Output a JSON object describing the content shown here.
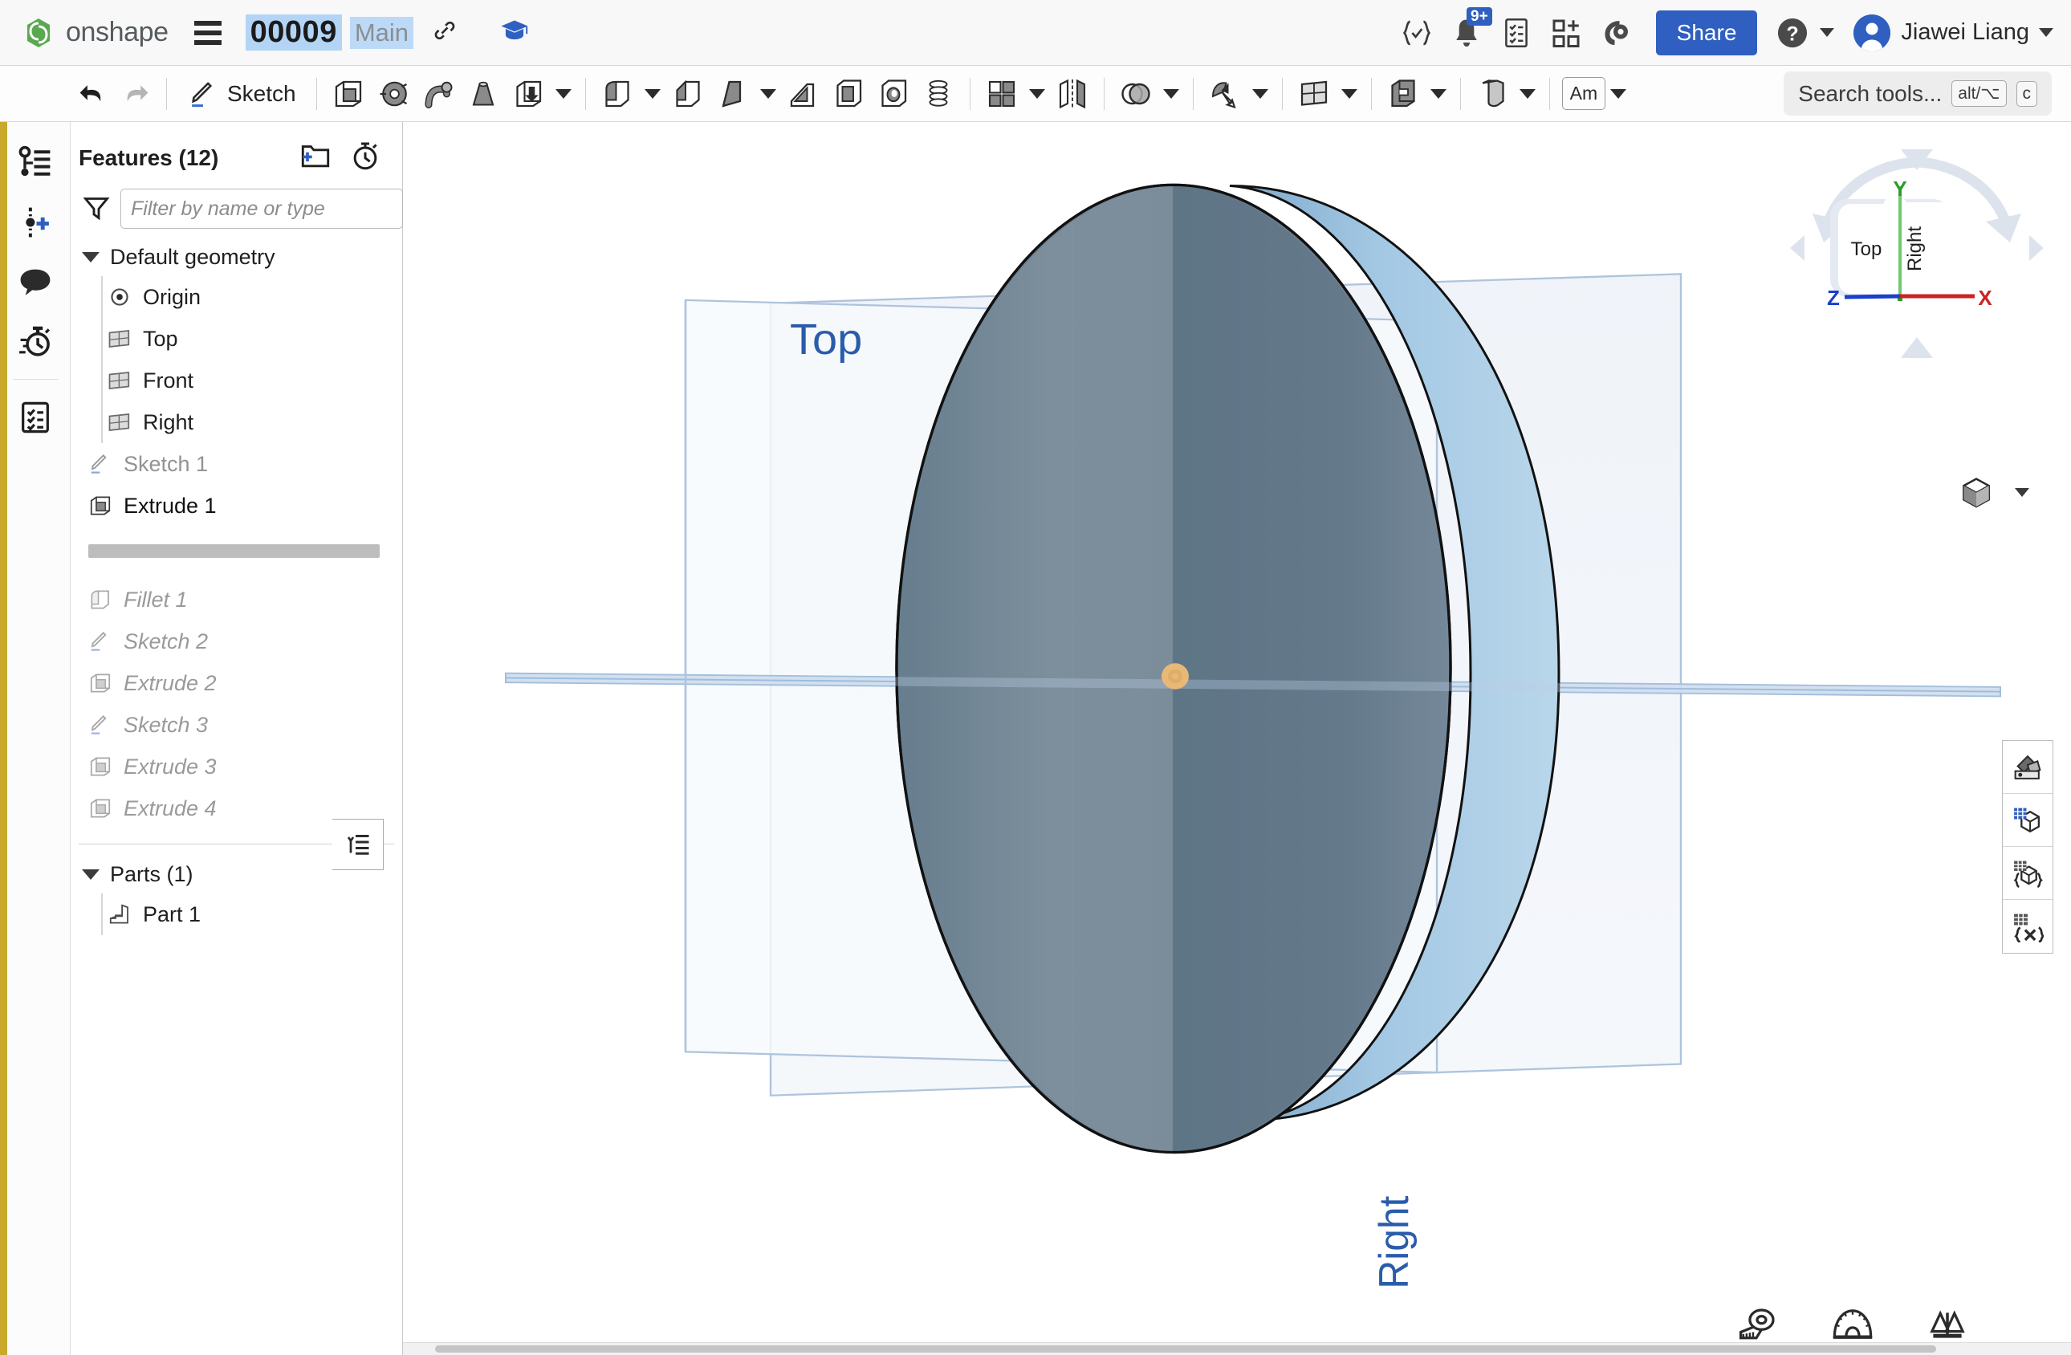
{
  "header": {
    "brand": "onshape",
    "document_title": "00009",
    "branch": "Main",
    "icons": {
      "menu": "hamburger-icon",
      "link": "link-icon",
      "learning": "graduation-cap-icon",
      "variables": "curly-check-icon",
      "notifications": "bell-icon",
      "tasks": "checklist-icon",
      "apps": "apps-add-icon",
      "ai": "brain-gear-icon",
      "help": "help-circle-icon"
    },
    "notification_badge": "9+",
    "share_label": "Share",
    "user_name": "Jiawei Liang",
    "accent_color": "#2f5fc0"
  },
  "toolbar": {
    "undo": "undo-icon",
    "redo": "redo-icon",
    "sketch_label": "Sketch",
    "tools": [
      {
        "name": "extrude-tool",
        "icon": "extrude-icon",
        "caret": false
      },
      {
        "name": "revolve-tool",
        "icon": "revolve-icon",
        "caret": false
      },
      {
        "name": "sweep-tool",
        "icon": "sweep-icon",
        "caret": false
      },
      {
        "name": "loft-tool",
        "icon": "loft-icon",
        "caret": false
      },
      {
        "name": "thicken-tool",
        "icon": "thicken-icon",
        "caret": true
      },
      {
        "name": "fillet-tool",
        "icon": "fillet-icon",
        "caret": true
      },
      {
        "name": "chamfer-tool",
        "icon": "chamfer-icon",
        "caret": false
      },
      {
        "name": "draft-tool",
        "icon": "draft-icon",
        "caret": true
      },
      {
        "name": "rib-tool",
        "icon": "rib-icon",
        "caret": false
      },
      {
        "name": "shell-tool",
        "icon": "shell-icon",
        "caret": false
      },
      {
        "name": "hole-tool",
        "icon": "hole-icon",
        "caret": false
      },
      {
        "name": "helix-tool",
        "icon": "helix-icon",
        "caret": false
      },
      {
        "name": "pattern-tool",
        "icon": "pattern-icon",
        "caret": true
      },
      {
        "name": "mirror-tool",
        "icon": "mirror-icon",
        "caret": false
      },
      {
        "name": "boolean-tool",
        "icon": "boolean-icon",
        "caret": true
      },
      {
        "name": "transform-tool",
        "icon": "transform-icon",
        "caret": true
      },
      {
        "name": "plane-tool",
        "icon": "plane-icon",
        "caret": true
      },
      {
        "name": "split-tool",
        "icon": "split-icon",
        "caret": true
      },
      {
        "name": "sheetmetal-tool",
        "icon": "sheet-metal-icon",
        "caret": true
      }
    ],
    "am_label": "Am",
    "search_placeholder": "Search tools...",
    "search_kbd_1": "alt/⌥",
    "search_kbd_2": "c"
  },
  "rail": {
    "items": [
      {
        "name": "feature-list-icon",
        "label": "Feature list"
      },
      {
        "name": "add-version-icon",
        "label": "Add version"
      },
      {
        "name": "comments-icon",
        "label": "Comments"
      },
      {
        "name": "history-icon",
        "label": "History"
      },
      {
        "name": "tasks-checklist-icon",
        "label": "Tasks"
      }
    ],
    "accent_stripe": "#c8a92b"
  },
  "tree": {
    "title": "Features (12)",
    "new_folder_icon": "folder-plus-icon",
    "rollback_icon": "rollback-timer-icon",
    "filter_icon": "funnel-icon",
    "filter_placeholder": "Filter by name or type",
    "default_geometry_label": "Default geometry",
    "default_geometry": [
      {
        "label": "Origin",
        "icon": "origin-icon",
        "state": "normal"
      },
      {
        "label": "Top",
        "icon": "plane-icon",
        "state": "normal"
      },
      {
        "label": "Front",
        "icon": "plane-icon",
        "state": "normal"
      },
      {
        "label": "Right",
        "icon": "plane-icon",
        "state": "normal"
      }
    ],
    "features_before_rollback": [
      {
        "label": "Sketch 1",
        "icon": "sketch-icon",
        "state": "consumed"
      },
      {
        "label": "Extrude 1",
        "icon": "extrude-icon",
        "state": "active"
      }
    ],
    "features_after_rollback": [
      {
        "label": "Fillet 1",
        "icon": "fillet-icon",
        "state": "rolled"
      },
      {
        "label": "Sketch 2",
        "icon": "sketch-icon",
        "state": "rolled"
      },
      {
        "label": "Extrude 2",
        "icon": "extrude-icon",
        "state": "rolled"
      },
      {
        "label": "Sketch 3",
        "icon": "sketch-icon",
        "state": "rolled"
      },
      {
        "label": "Extrude 3",
        "icon": "extrude-icon",
        "state": "rolled"
      },
      {
        "label": "Extrude 4",
        "icon": "extrude-icon",
        "state": "rolled"
      }
    ],
    "parts_label": "Parts (1)",
    "parts": [
      {
        "label": "Part 1",
        "icon": "part-icon"
      }
    ],
    "flyout_icon": "tree-flyout-icon"
  },
  "viewport": {
    "plane_labels": {
      "top": "Top",
      "right": "Right"
    },
    "plane_label_color": "#2a5caa",
    "origin_color": "#e8b877",
    "model": {
      "name": "cylinder",
      "face_color_light": "#7d8f9d",
      "face_color_mid": "#6b7f8f",
      "face_color_dark": "#5c7384",
      "rim_color": "#9dc4e0",
      "edge_color": "#1a1a1a"
    },
    "view_cube": {
      "top_face": "Top",
      "right_face": "Right",
      "axis_x": "X",
      "axis_y": "Y",
      "axis_z": "Z",
      "axis_x_color": "#cc2222",
      "axis_y_color": "#2a9c2a",
      "axis_z_color": "#1a3fcc"
    },
    "display_mode_icon": "shaded-cube-icon",
    "right_tools": [
      {
        "name": "appearance-swatch-icon"
      },
      {
        "name": "display-state-cube-icon"
      },
      {
        "name": "configuration-cube-icon"
      },
      {
        "name": "variable-studio-icon"
      }
    ],
    "bottom_tools": [
      {
        "name": "measure-tape-icon"
      },
      {
        "name": "protractor-icon"
      },
      {
        "name": "mass-properties-icon"
      }
    ]
  }
}
